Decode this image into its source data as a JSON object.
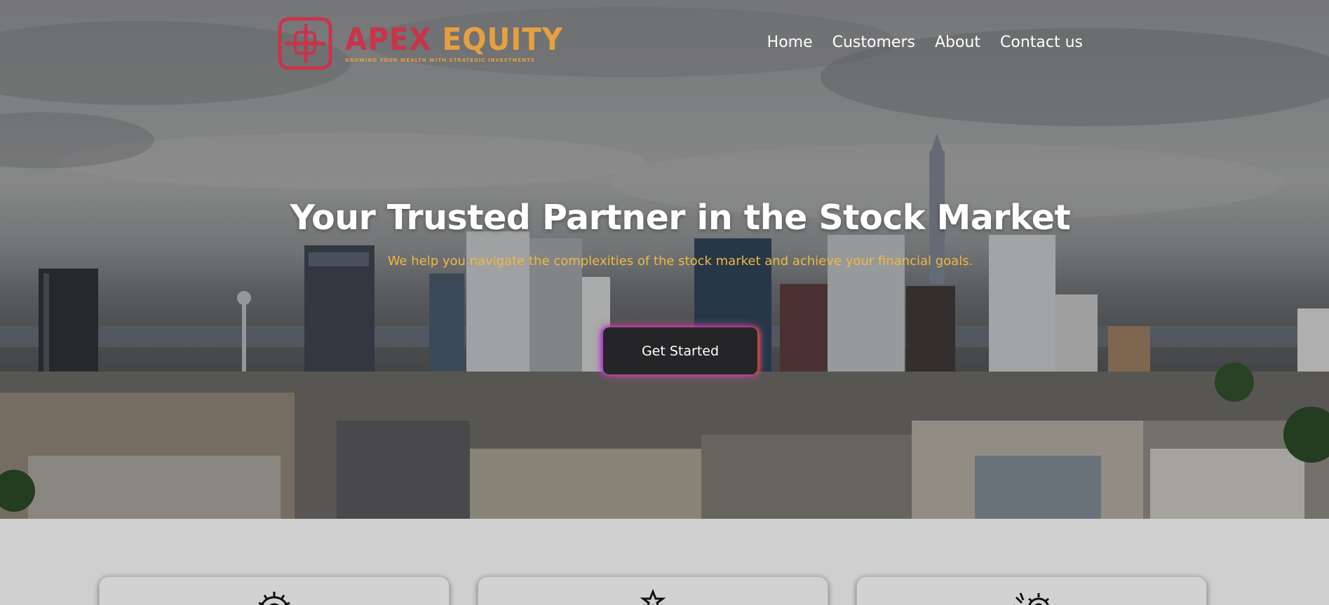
{
  "brand": {
    "name_part1": "APEX",
    "name_part2": "EQUITY",
    "tagline": "GROWING YOUR WEALTH WITH STRATEGIC INVESTMENTS",
    "colors": {
      "red": "#c9344a",
      "gold": "#e6a040"
    }
  },
  "nav": {
    "items": [
      {
        "label": "Home"
      },
      {
        "label": "Customers"
      },
      {
        "label": "About"
      },
      {
        "label": "Contact us"
      }
    ]
  },
  "hero": {
    "title": "Your Trusted Partner in the Stock Market",
    "subtitle": "We help you navigate the complexities of the stock market and achieve your financial goals.",
    "cta_label": "Get Started",
    "background": "city-skyline-image",
    "subtitle_color": "#f0b840",
    "button_color": "#252527"
  },
  "cards": [
    {
      "icon": "gear-icon"
    },
    {
      "icon": "star-icon"
    },
    {
      "icon": "gears-icon"
    }
  ]
}
